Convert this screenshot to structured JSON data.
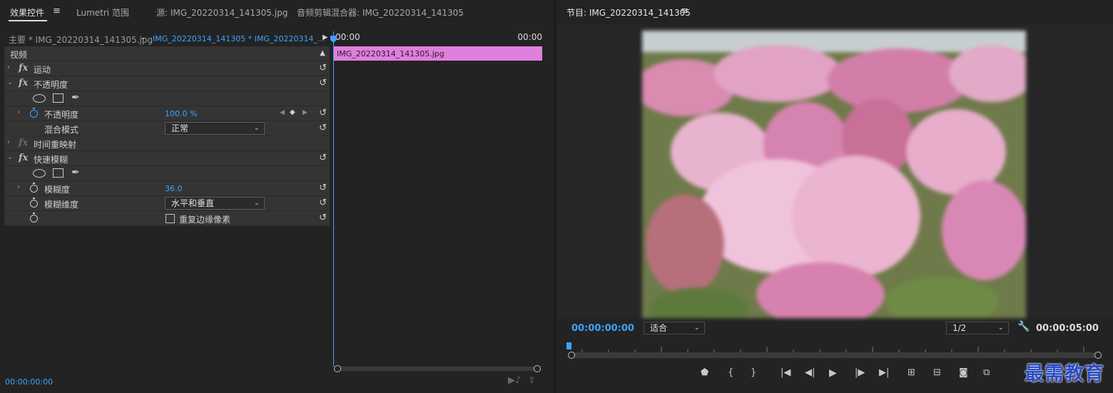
{
  "left_tabs": {
    "effect_controls": "效果控件",
    "lumetri": "Lumetri 范围",
    "source": "源: IMG_20220314_141305.jpg",
    "audio_mixer": "音频剪辑混合器: IMG_20220314_141305"
  },
  "source_bar": {
    "master": "主要 * IMG_20220314_141305.jpg",
    "sequence": "IMG_20220314_141305 * IMG_20220314_..."
  },
  "timeline_mini": {
    "time_start": "00:00",
    "time_end": "00:00",
    "clip_name": "IMG_20220314_141305.jpg",
    "clip_color": "#e07fde"
  },
  "effects": {
    "section": "视频",
    "motion": "运动",
    "opacity": "不透明度",
    "opacity_param": "不透明度",
    "opacity_value": "100.0 %",
    "blend_mode": "混合模式",
    "blend_mode_value": "正常",
    "time_remap": "时间重映射",
    "fast_blur": "快速模糊",
    "blurriness": "模糊度",
    "blurriness_value": "36.0",
    "blur_dimensions": "模糊维度",
    "blur_dimensions_value": "水平和垂直",
    "repeat_edge": "重复边缘像素"
  },
  "left_footer": {
    "timecode": "00:00:00:00"
  },
  "program": {
    "title": "节目: IMG_20220314_141305",
    "current_time": "00:00:00:00",
    "fit": "适合",
    "resolution": "1/2",
    "duration": "00:00:05:00"
  },
  "watermark": "最需教育",
  "colors": {
    "accent": "#3ea2ff",
    "panel_bg": "#232323",
    "row_bg": "#343434"
  }
}
